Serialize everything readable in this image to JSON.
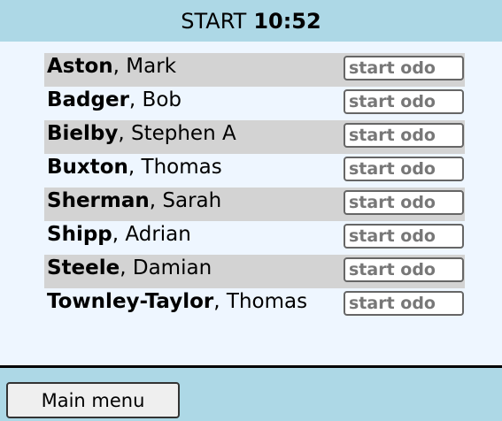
{
  "header": {
    "label": "START",
    "time": "10:52"
  },
  "drivers": [
    {
      "surname": "Aston",
      "given": "Mark"
    },
    {
      "surname": "Badger",
      "given": "Bob"
    },
    {
      "surname": "Bielby",
      "given": "Stephen A"
    },
    {
      "surname": "Buxton",
      "given": "Thomas"
    },
    {
      "surname": "Sherman",
      "given": "Sarah"
    },
    {
      "surname": "Shipp",
      "given": "Adrian"
    },
    {
      "surname": "Steele",
      "given": "Damian"
    },
    {
      "surname": "Townley-Taylor",
      "given": "Thomas"
    }
  ],
  "odo_placeholder": "start odo",
  "name_separator": ", ",
  "footer": {
    "main_menu_label": "Main menu"
  },
  "colors": {
    "header_bg": "#add8e6",
    "row_shade": "#d3d3d3",
    "panel_bg": "#eef6ff"
  }
}
